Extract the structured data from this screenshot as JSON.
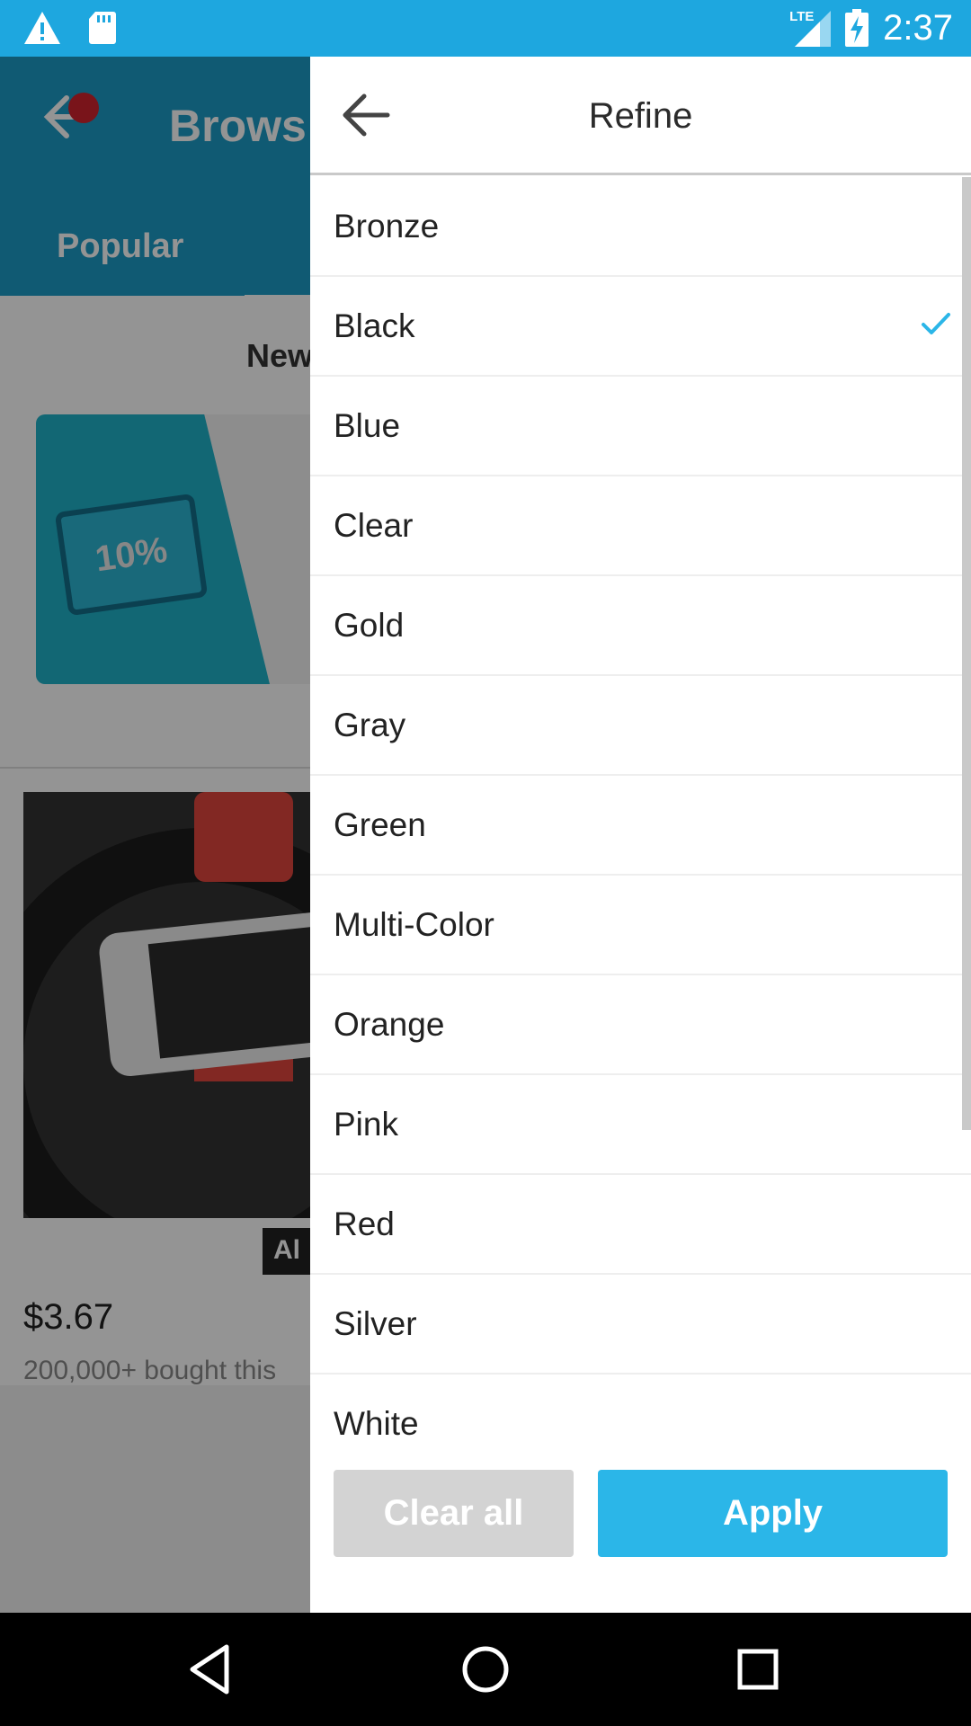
{
  "status_bar": {
    "time": "2:37",
    "network": "LTE",
    "icons": [
      "warning-icon",
      "sd-card-icon",
      "signal-icon",
      "battery-charging-icon"
    ],
    "color": "#1ea7df"
  },
  "background_app": {
    "title": "Brows",
    "tab_active": "Popular",
    "section_title": "New",
    "promo_badge": "10%",
    "product": {
      "badge": "Al",
      "price": "$3.67",
      "bought_text": "200,000+ bought this"
    }
  },
  "drawer": {
    "title": "Refine",
    "options": [
      {
        "label": "Bronze",
        "selected": false
      },
      {
        "label": "Black",
        "selected": true
      },
      {
        "label": "Blue",
        "selected": false
      },
      {
        "label": "Clear",
        "selected": false
      },
      {
        "label": "Gold",
        "selected": false
      },
      {
        "label": "Gray",
        "selected": false
      },
      {
        "label": "Green",
        "selected": false
      },
      {
        "label": "Multi-Color",
        "selected": false
      },
      {
        "label": "Orange",
        "selected": false
      },
      {
        "label": "Pink",
        "selected": false
      },
      {
        "label": "Red",
        "selected": false
      },
      {
        "label": "Silver",
        "selected": false
      },
      {
        "label": "White",
        "selected": false
      }
    ],
    "clear_label": "Clear all",
    "apply_label": "Apply",
    "accent_color": "#2bb6e8"
  },
  "nav_bar": {
    "buttons": [
      "back-triangle-icon",
      "home-circle-icon",
      "recents-square-icon"
    ]
  }
}
